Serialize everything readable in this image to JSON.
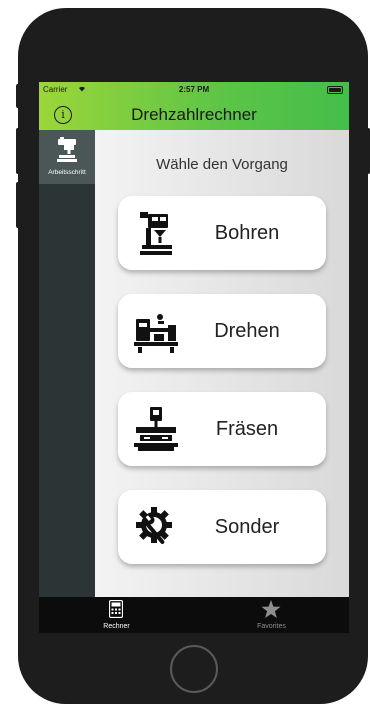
{
  "status": {
    "carrier": "Carrier",
    "time": "2:57 PM"
  },
  "navbar": {
    "title": "Drehzahlrechner",
    "info_icon": "info-icon"
  },
  "sidebar": {
    "items": [
      {
        "label": "Arbeitsschritt",
        "icon": "drill-press-icon",
        "active": true
      }
    ]
  },
  "main": {
    "heading": "Wähle den Vorgang",
    "options": [
      {
        "label": "Bohren",
        "icon": "drill-press-icon"
      },
      {
        "label": "Drehen",
        "icon": "lathe-icon"
      },
      {
        "label": "Fräsen",
        "icon": "milling-machine-icon"
      },
      {
        "label": "Sonder",
        "icon": "gear-wrench-icon"
      }
    ]
  },
  "tabbar": {
    "tabs": [
      {
        "label": "Rechner",
        "icon": "calculator-icon",
        "active": true
      },
      {
        "label": "Favorites",
        "icon": "star-icon",
        "active": false
      }
    ]
  },
  "colors": {
    "accent_start": "#9bd63a",
    "accent_end": "#44be4a",
    "sidebar": "#2c3535",
    "tabbar": "#0c0c0c"
  }
}
